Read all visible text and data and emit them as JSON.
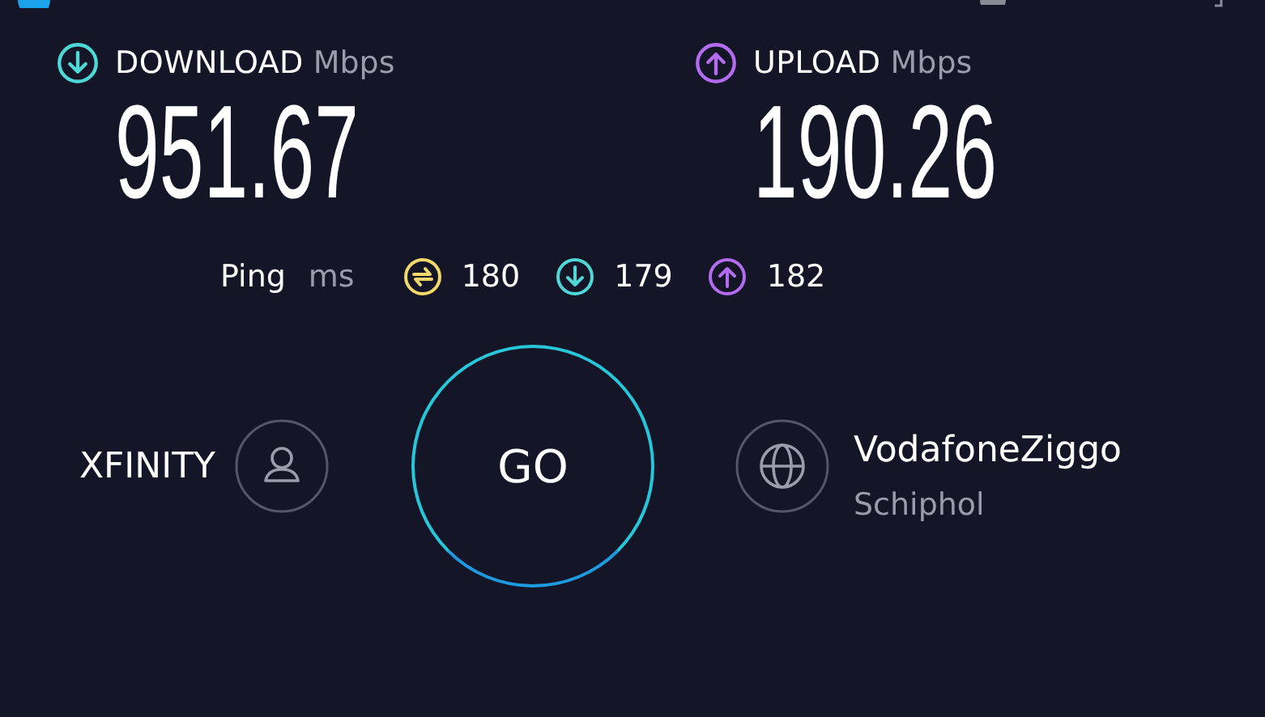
{
  "results": [
    {
      "kind": "download",
      "label": "DOWNLOAD",
      "unit": "Mbps",
      "value": "951.67"
    },
    {
      "kind": "upload",
      "label": "UPLOAD",
      "unit": "Mbps",
      "value": "190.26"
    }
  ],
  "ping": {
    "label": "Ping",
    "unit": "ms",
    "values": [
      {
        "kind": "idle",
        "value": "180"
      },
      {
        "kind": "download",
        "value": "179"
      },
      {
        "kind": "upload",
        "value": "182"
      }
    ]
  },
  "provider": {
    "name": "XFINITY"
  },
  "go_button": {
    "label": "GO"
  },
  "server": {
    "name": "VodafoneZiggo",
    "location": "Schiphol"
  }
}
